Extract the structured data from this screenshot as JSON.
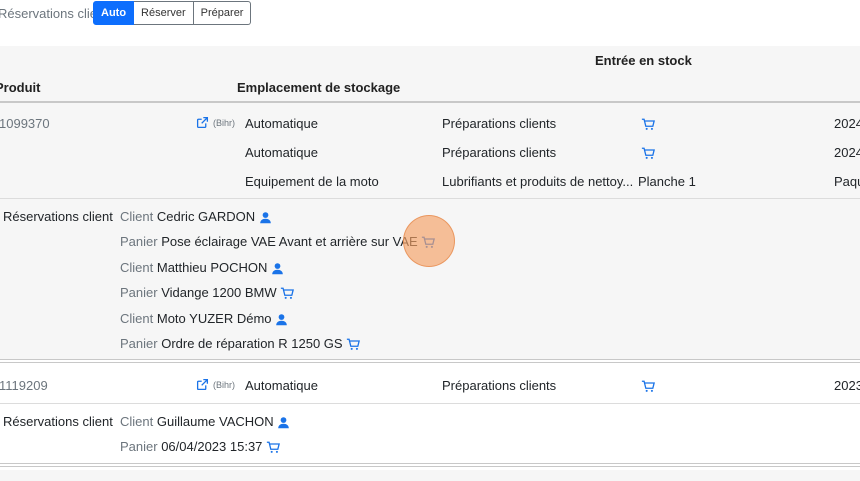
{
  "topbar": {
    "label": "Réservations client",
    "buttons": [
      {
        "label": "Auto",
        "active": true
      },
      {
        "label": "Réserver",
        "active": false
      },
      {
        "label": "Préparer",
        "active": false
      }
    ]
  },
  "header": {
    "produit": "Produit",
    "emplacement": "Emplacement de stockage",
    "entree": "Entrée en stock"
  },
  "product1": {
    "ref": "1099370",
    "supplier": "(Bihr)",
    "locations": [
      {
        "type": "Automatique",
        "zone": "Préparations clients",
        "place": "",
        "date": "2024"
      },
      {
        "type": "Automatique",
        "zone": "Préparations clients",
        "place": "",
        "date": "2024"
      },
      {
        "type": "Equipement de la moto",
        "zone": "Lubrifiants et produits de nettoy...",
        "place": "Planche 1",
        "date": "Paqu"
      }
    ],
    "reservations_label": "Réservations client",
    "reservations": [
      {
        "kind": "Client",
        "value": "Cedric GARDON",
        "icon": "user-icon"
      },
      {
        "kind": "Panier",
        "value": "Pose éclairage VAE Avant et arrière sur VAE",
        "icon": "cart-icon"
      },
      {
        "kind": "Client",
        "value": "Matthieu POCHON",
        "icon": "user-icon"
      },
      {
        "kind": "Panier",
        "value": "Vidange 1200 BMW",
        "icon": "cart-icon"
      },
      {
        "kind": "Client",
        "value": "Moto YUZER Démo",
        "icon": "user-icon"
      },
      {
        "kind": "Panier",
        "value": "Ordre de réparation R 1250 GS",
        "icon": "cart-icon"
      }
    ]
  },
  "product2": {
    "ref": "1119209",
    "supplier": "(Bihr)",
    "locations": [
      {
        "type": "Automatique",
        "zone": "Préparations clients",
        "place": "",
        "date": "2023"
      }
    ],
    "reservations_label": "Réservations client",
    "reservations": [
      {
        "kind": "Client",
        "value": "Guillaume VACHON",
        "icon": "user-icon"
      },
      {
        "kind": "Panier",
        "value": "06/04/2023 15:37",
        "icon": "cart-icon"
      }
    ]
  },
  "colors": {
    "accent": "#1a73e8",
    "primary_button": "#0d6efd",
    "cursor": "#f5a064"
  }
}
